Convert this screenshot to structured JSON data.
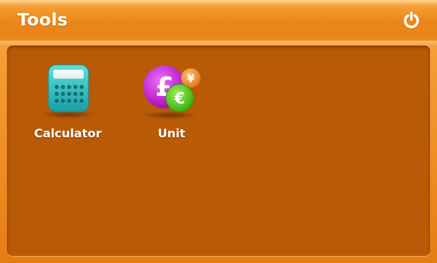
{
  "header": {
    "title": "Tools",
    "power_icon": "power-icon"
  },
  "apps": [
    {
      "label": "Calculator",
      "icon": "calculator-icon"
    },
    {
      "label": "Unit",
      "icon": "currency-unit-icon"
    }
  ],
  "colors": {
    "header_orange": "#ea8617",
    "panel_brown": "#b85a06",
    "calculator_teal": "#2ec3c4",
    "pound_purple": "#c81fd6",
    "euro_green": "#5fd21a",
    "yen_orange": "#f2973a",
    "text_white": "#ffffff"
  },
  "currency_symbols": {
    "pound": "£",
    "euro": "€",
    "yen": "¥"
  }
}
